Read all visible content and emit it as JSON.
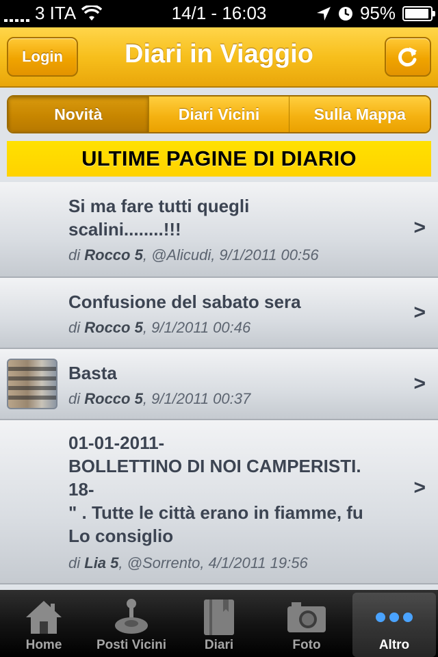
{
  "status_bar": {
    "carrier": "3 ITA",
    "time": "14/1 - 16:03",
    "battery": "95%",
    "battery_level": 0.95
  },
  "nav": {
    "title": "Diari in Viaggio",
    "login_label": "Login"
  },
  "segments": [
    {
      "label": "Novità",
      "selected": true
    },
    {
      "label": "Diari Vicini",
      "selected": false
    },
    {
      "label": "Sulla Mappa",
      "selected": false
    }
  ],
  "section_title": "ULTIME PAGINE DI DIARIO",
  "entries": [
    {
      "title": "Si ma fare tutti quegli\nscalini........!!!",
      "by": "di",
      "author": "Rocco 5",
      "rest": ", @Alicudi, 9/1/2011 00:56",
      "has_thumbnail": false
    },
    {
      "title": "Confusione del sabato sera",
      "by": "di",
      "author": "Rocco 5",
      "rest": ", 9/1/2011 00:46",
      "has_thumbnail": false
    },
    {
      "title": "Basta",
      "by": "di",
      "author": "Rocco 5",
      "rest": ", 9/1/2011 00:37",
      "has_thumbnail": true
    },
    {
      "title": "01-01-2011-\nBOLLETTINO DI NOI CAMPERISTI.\n18-\n\" . Tutte le città erano in fiamme, fu\nLo consiglio",
      "by": "di",
      "author": "Lia 5",
      "rest": ", @Sorrento, 4/1/2011 19:56",
      "has_thumbnail": false
    }
  ],
  "chevron": ">",
  "tabs": [
    {
      "label": "Home",
      "icon": "home-icon",
      "selected": false
    },
    {
      "label": "Posti Vicini",
      "icon": "joystick-icon",
      "selected": false
    },
    {
      "label": "Diari",
      "icon": "book-icon",
      "selected": false
    },
    {
      "label": "Foto",
      "icon": "camera-icon",
      "selected": false
    },
    {
      "label": "Altro",
      "icon": "more-icon",
      "selected": true
    }
  ]
}
